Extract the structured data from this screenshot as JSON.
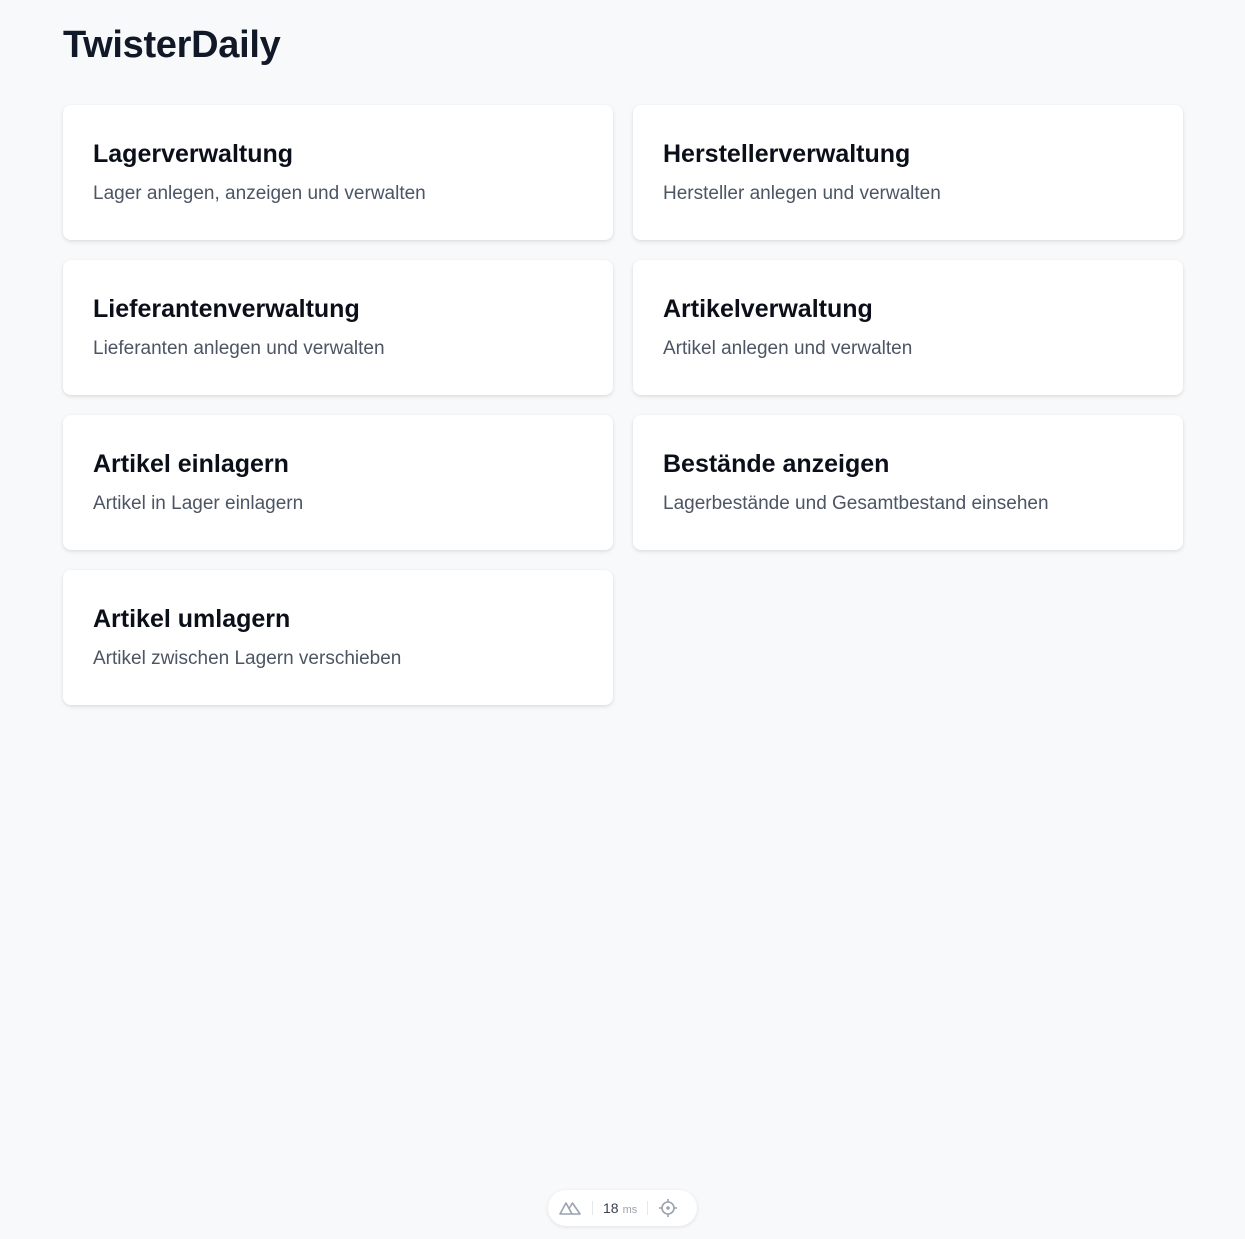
{
  "header": {
    "title": "TwisterDaily"
  },
  "cards": [
    {
      "title": "Lagerverwaltung",
      "description": "Lager anlegen, anzeigen und verwalten"
    },
    {
      "title": "Herstellerverwaltung",
      "description": "Hersteller anlegen und verwalten"
    },
    {
      "title": "Lieferantenverwaltung",
      "description": "Lieferanten anlegen und verwalten"
    },
    {
      "title": "Artikelverwaltung",
      "description": "Artikel anlegen und verwalten"
    },
    {
      "title": "Artikel einlagern",
      "description": "Artikel in Lager einlagern"
    },
    {
      "title": "Bestände anzeigen",
      "description": "Lagerbestände und Gesamtbestand einsehen"
    },
    {
      "title": "Artikel umlagern",
      "description": "Artikel zwischen Lagern verschieben"
    }
  ],
  "devtools": {
    "logo_icon": "nuxt-logo-icon",
    "timing_value": "18",
    "timing_unit": "ms",
    "inspect_icon": "crosshair-icon"
  },
  "colors": {
    "background": "#f8f9fb",
    "card": "#ffffff",
    "title": "#111827",
    "description": "#4b5563"
  }
}
